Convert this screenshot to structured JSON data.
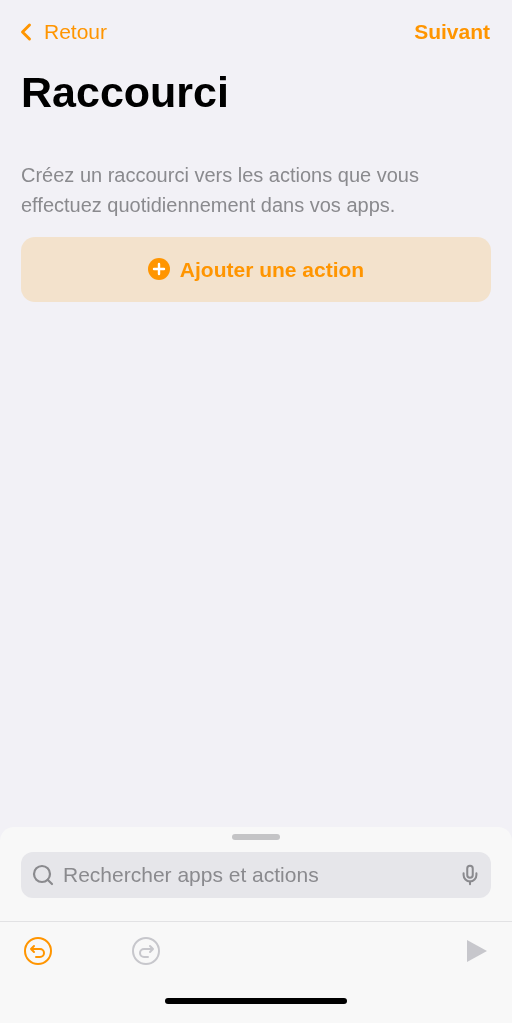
{
  "nav": {
    "back": "Retour",
    "next": "Suivant"
  },
  "title": "Raccourci",
  "description": "Créez un raccourci vers les actions que vous effectuez quotidiennement dans vos apps.",
  "add_action": {
    "label": "Ajouter une action"
  },
  "search": {
    "placeholder": "Rechercher apps et actions"
  },
  "toolbar": [
    {
      "kind": "undo",
      "disabled": false
    },
    {
      "kind": "redo",
      "disabled": true
    },
    {
      "kind": "run",
      "disabled": true
    }
  ]
}
